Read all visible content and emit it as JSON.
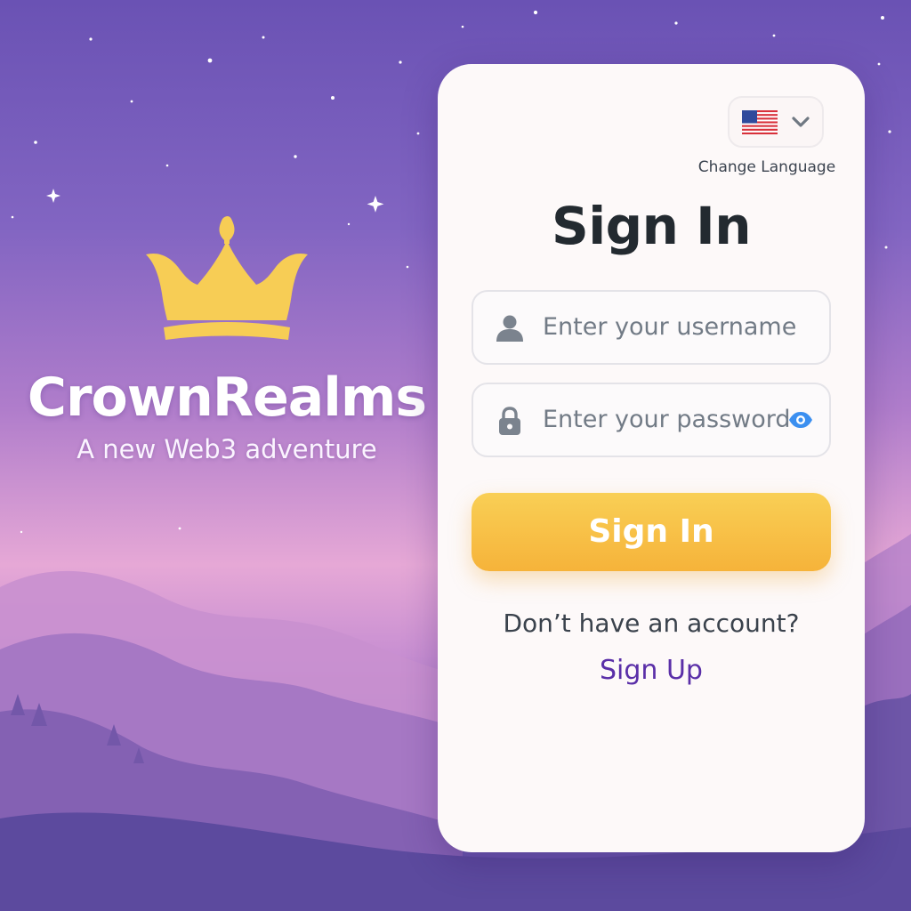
{
  "brand": {
    "name": "CrownRealms",
    "tagline": "A new Web3 adventure",
    "logo_icon": "crown-icon",
    "logo_color": "#f7cd55"
  },
  "language": {
    "selected_flag": "us-flag-icon",
    "dropdown_icon": "chevron-down-icon",
    "label": "Change Language"
  },
  "signin": {
    "title": "Sign In",
    "username": {
      "icon": "user-icon",
      "value": "",
      "placeholder": "Enter your username"
    },
    "password": {
      "icon": "lock-icon",
      "value": "",
      "placeholder": "Enter your password",
      "toggle_icon": "eye-icon"
    },
    "submit_label": "Sign In",
    "no_account_text": "Don’t have an account?",
    "signup_label": "Sign Up"
  },
  "colors": {
    "accent": "#f6b33a",
    "link": "#5a2fa8",
    "background_top": "#6a52b4",
    "background_glow": "#e6a8d6"
  }
}
